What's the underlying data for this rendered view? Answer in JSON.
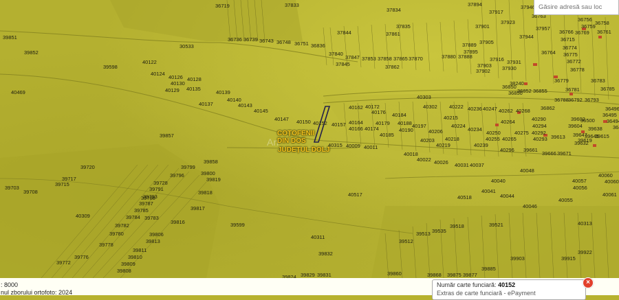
{
  "search": {
    "placeholder": "Găsire adresă sau loc"
  },
  "map": {
    "locality_line1": "COȚOFENII",
    "locality_line2": "DIN DOS",
    "county": "JUDEȚUL DOLJ",
    "watermark": "An",
    "selected_parcel": "40152",
    "parcel_numbers": [
      "36719",
      "37833",
      "37834",
      "37894",
      "37917",
      "37946",
      "37923",
      "37944",
      "37957",
      "37901",
      "37905",
      "37889",
      "37895",
      "37916",
      "37931",
      "37930",
      "37902",
      "37903",
      "37880",
      "37888",
      "37870",
      "37865",
      "37858",
      "37853",
      "37847",
      "37840",
      "37845",
      "37862",
      "37861",
      "37835",
      "37844",
      "36736",
      "36739",
      "36743",
      "36748",
      "36751",
      "36836",
      "30533",
      "39851",
      "39852",
      "39598",
      "40122",
      "40124",
      "40126",
      "40130",
      "40128",
      "40129",
      "40135",
      "40469",
      "40139",
      "40140",
      "40137",
      "40143",
      "40145",
      "40147",
      "40150",
      "40162",
      "40172",
      "40176",
      "40184",
      "40188",
      "40190",
      "40197",
      "40157",
      "40164",
      "40166",
      "40174",
      "40179",
      "40185",
      "40302",
      "40303",
      "40222",
      "40236",
      "40247",
      "40262",
      "40268",
      "40215",
      "40224",
      "40234",
      "40206",
      "40203",
      "40218",
      "40219",
      "40239",
      "40250",
      "40255",
      "40265",
      "40264",
      "40275",
      "40292",
      "40294",
      "40290",
      "40293",
      "40315",
      "40009",
      "40011",
      "40018",
      "40022",
      "40026",
      "40031",
      "40037",
      "39857",
      "39858",
      "39720",
      "39799",
      "39796",
      "39800",
      "39819",
      "39818",
      "39817",
      "39816",
      "39703",
      "39708",
      "39717",
      "39715",
      "39728",
      "39791",
      "39793",
      "39788",
      "39787",
      "39785",
      "39784",
      "39783",
      "39782",
      "39780",
      "39778",
      "39776",
      "39772",
      "39813",
      "39811",
      "39810",
      "39809",
      "39808",
      "39806",
      "39599",
      "40309",
      "40311",
      "39832",
      "39829",
      "39831",
      "39824",
      "39860",
      "39868",
      "39875",
      "39877",
      "39885",
      "39512",
      "39513",
      "39518",
      "39521",
      "39535",
      "40517",
      "40518",
      "40041",
      "40044",
      "40040",
      "40048",
      "40046",
      "40055",
      "40056",
      "40057",
      "40060",
      "40061",
      "40313",
      "39903",
      "39915",
      "39922",
      "39661",
      "39666",
      "39671",
      "39632",
      "39619",
      "39615",
      "39638",
      "39645",
      "39647",
      "39604",
      "39602",
      "39613",
      "36862",
      "36850",
      "36852",
      "36855",
      "36788",
      "36792",
      "36793",
      "36778",
      "36779",
      "36781",
      "36783",
      "36774",
      "36772",
      "36775",
      "36764",
      "36766",
      "36769",
      "36756",
      "36759",
      "36763",
      "36758",
      "36761",
      "36715",
      "36785",
      "36850",
      "36496",
      "36495",
      "36494",
      "36500",
      "36494",
      "40060",
      "40296",
      "38240"
    ]
  },
  "bottom_bar": {
    "scale": ": 8000",
    "ortho_year": "nul zborului ortofoto: 2024"
  },
  "popup": {
    "title_label": "Număr carte funciară:",
    "title_value": "40152",
    "subtitle": "Extras de carte funciară - ePayment"
  },
  "colors": {
    "map": "#b4b030",
    "label": "#f3c21c",
    "close": "#e2402c"
  }
}
